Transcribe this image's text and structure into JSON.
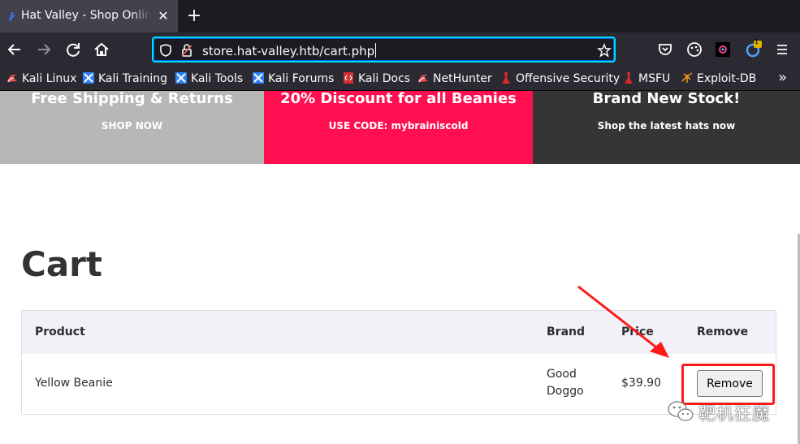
{
  "browser": {
    "tab": {
      "title": "Hat Valley - Shop Online!",
      "close_label": "✕"
    },
    "new_tab_label": "+",
    "url": "store.hat-valley.htb/cart.php",
    "notification_count": "1",
    "bookmarks": [
      {
        "label": "Kali Linux",
        "icon": "kali-icon"
      },
      {
        "label": "Kali Training",
        "icon": "kali-tools-icon"
      },
      {
        "label": "Kali Tools",
        "icon": "kali-tools-icon"
      },
      {
        "label": "Kali Forums",
        "icon": "kali-tools-icon"
      },
      {
        "label": "Kali Docs",
        "icon": "kali-docs-icon"
      },
      {
        "label": "NetHunter",
        "icon": "kali-icon"
      },
      {
        "label": "Offensive Security",
        "icon": "offsec-icon"
      },
      {
        "label": "MSFU",
        "icon": "offsec-icon"
      },
      {
        "label": "Exploit-DB",
        "icon": "exploitdb-icon"
      }
    ],
    "overflow_label": "»"
  },
  "banner": [
    {
      "title": "Free Shipping & Returns",
      "subtitle": "SHOP NOW",
      "color": "#b7b7b7"
    },
    {
      "title": "20% Discount for all Beanies",
      "subtitle": "USE CODE: mybrainiscold",
      "color": "#ff0f4f"
    },
    {
      "title": "Brand New Stock!",
      "subtitle": "Shop the latest hats now",
      "color": "#353535"
    }
  ],
  "page": {
    "title": "Cart",
    "table": {
      "headers": {
        "product": "Product",
        "brand": "Brand",
        "price": "Price",
        "remove": "Remove"
      },
      "rows": [
        {
          "product": "Yellow Beanie",
          "brand_line1": "Good",
          "brand_line2": "Doggo",
          "price": "$39.90",
          "remove_label": "Remove"
        }
      ]
    }
  },
  "watermark": {
    "text": "靶机狂魔"
  },
  "colors": {
    "annotation": "#ff1a1a",
    "url_focus": "#00ddff"
  }
}
